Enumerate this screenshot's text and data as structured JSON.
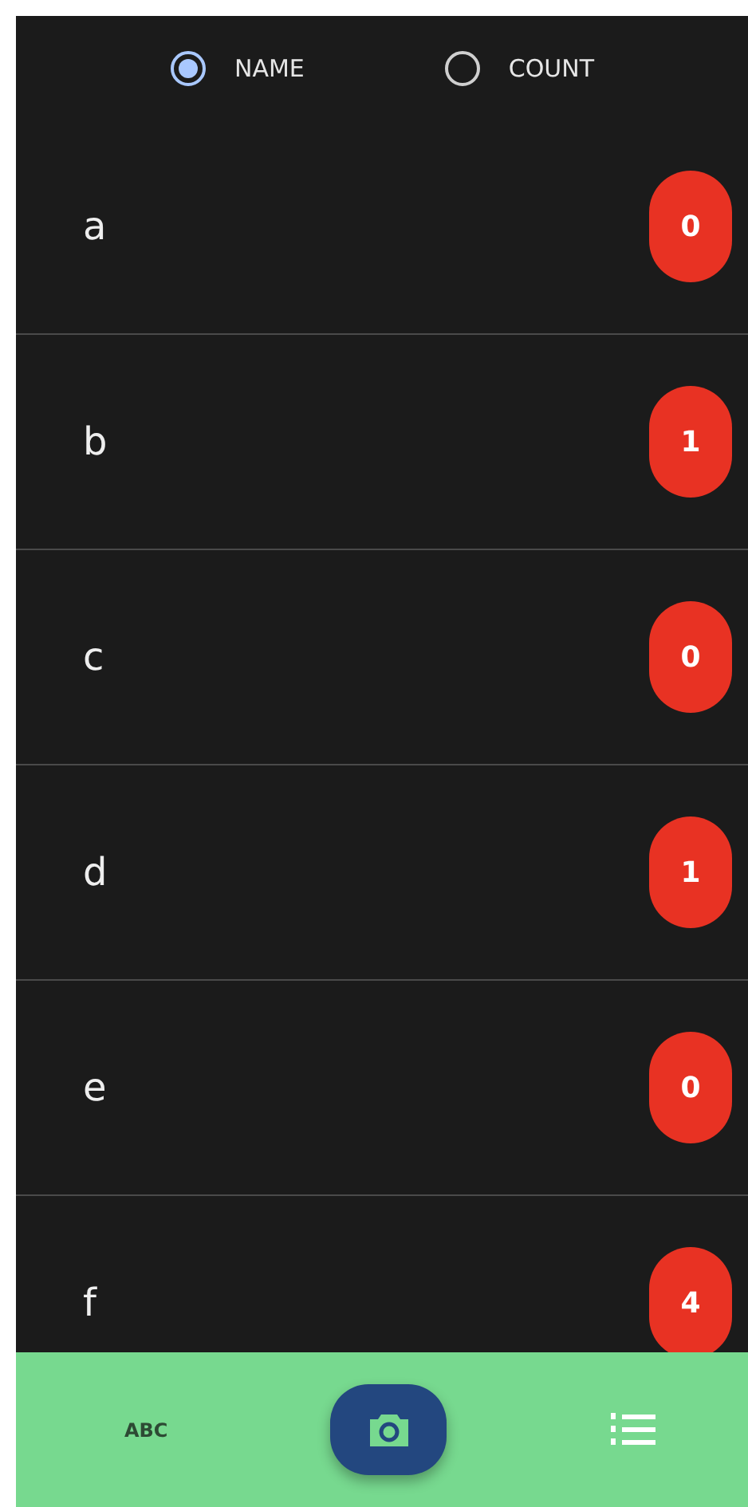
{
  "sort_options": [
    {
      "label": "NAME",
      "selected": true
    },
    {
      "label": "COUNT",
      "selected": false
    }
  ],
  "items": [
    {
      "name": "a",
      "count": "0"
    },
    {
      "name": "b",
      "count": "1"
    },
    {
      "name": "c",
      "count": "0"
    },
    {
      "name": "d",
      "count": "1"
    },
    {
      "name": "e",
      "count": "0"
    },
    {
      "name": "f",
      "count": "4"
    }
  ],
  "bottom_bar": {
    "left_label": "ABC"
  }
}
